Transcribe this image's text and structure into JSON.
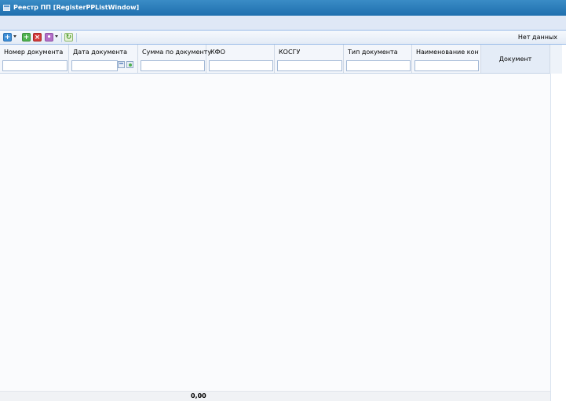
{
  "window": {
    "title": "Реестр ПП [RegisterPPListWindow]"
  },
  "toolbar": {
    "buttons": [
      {
        "name": "add-dropdown",
        "icon": "add-icon",
        "color": "#3d8fd8"
      },
      {
        "name": "create",
        "icon": "plus-icon",
        "color": "#4fb34f"
      },
      {
        "name": "delete",
        "icon": "delete-icon",
        "color": "#d43b3b"
      },
      {
        "name": "actions-dropdown",
        "icon": "actions-icon",
        "color": "#b46fc8"
      },
      {
        "name": "refresh",
        "icon": "refresh-icon",
        "color": "#6ab24a"
      }
    ],
    "status": "Нет данных"
  },
  "grid": {
    "columns": [
      {
        "key": "doc_number",
        "label": "Номер документа",
        "filter_value": ""
      },
      {
        "key": "doc_date",
        "label": "Дата документа",
        "filter_value": ""
      },
      {
        "key": "doc_sum",
        "label": "Сумма по документу",
        "filter_value": ""
      },
      {
        "key": "kfo",
        "label": "КФО",
        "filter_value": ""
      },
      {
        "key": "kosgu",
        "label": "КОСГУ",
        "filter_value": ""
      },
      {
        "key": "doc_type",
        "label": "Тип документа",
        "filter_value": ""
      },
      {
        "key": "contractor",
        "label": "Наименование конт...",
        "filter_value": ""
      }
    ],
    "document_column_label": "Документ",
    "rows": []
  },
  "footer": {
    "total_sum": "0,00"
  }
}
